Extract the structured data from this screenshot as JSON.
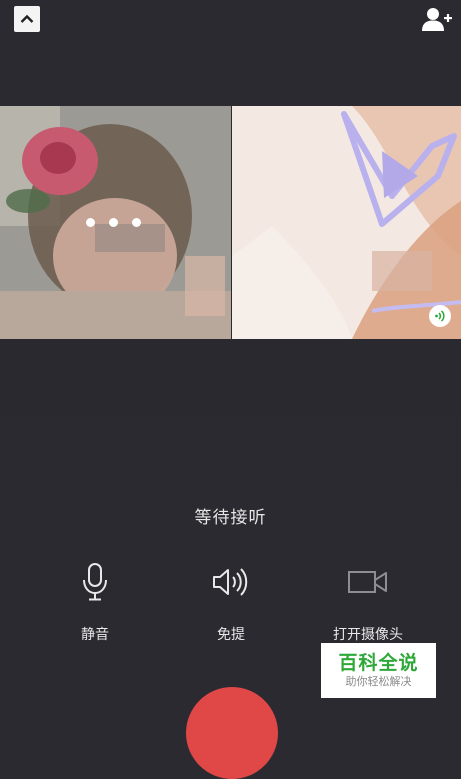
{
  "header": {
    "collapse_icon": "chevron-up-icon",
    "add_member_icon": "add-user-icon"
  },
  "tiles": {
    "left": {
      "state": "connecting",
      "indicator_icon": "three-dots-icon"
    },
    "right": {
      "badge_icon": "signal-wave-icon",
      "badge_color": "#2fa83a"
    }
  },
  "status": {
    "text": "等待接听"
  },
  "controls": {
    "mute": {
      "label": "静音",
      "icon": "microphone-icon"
    },
    "speaker": {
      "label": "免提",
      "icon": "speaker-icon"
    },
    "camera": {
      "label": "打开摄像头",
      "icon": "video-camera-icon"
    }
  },
  "hangup": {
    "icon": "hangup-icon",
    "color": "#e04848"
  },
  "watermark": {
    "title": "百科全说",
    "subtitle": "助你轻松解决"
  }
}
